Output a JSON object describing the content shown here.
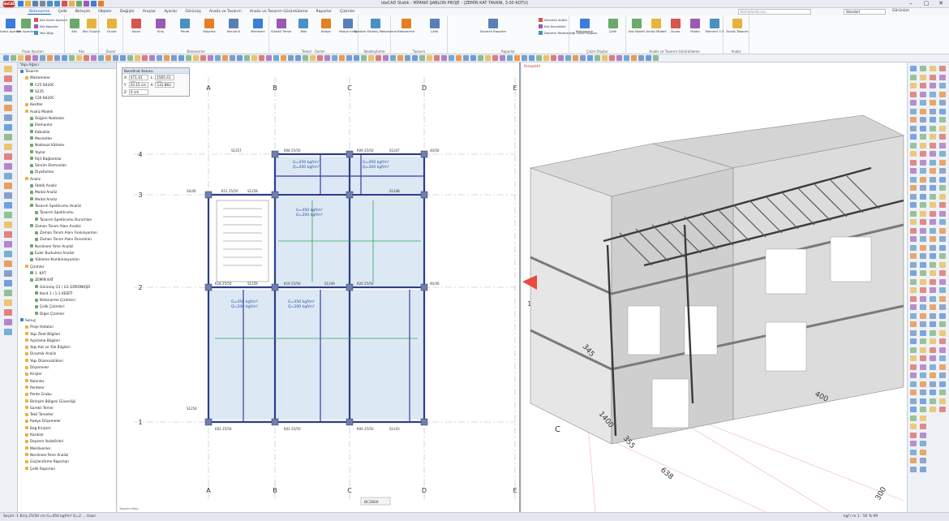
{
  "app": {
    "logo": "ideCAD",
    "title": "ideCAD Statik - MİMARİ ŞABLON PROJE - (ZEMİN KAT TAVANI, 3.00 KOTU)"
  },
  "window_controls": {
    "minimize": "–",
    "maximize": "▢",
    "close": "✕"
  },
  "tabs": [
    "Betonarme",
    "Çelik",
    "Birleşim",
    "Objeler",
    "Değiştir",
    "Araçlar",
    "Ayarlar",
    "Görünüş",
    "Analiz ve Tasarım",
    "Analiz ve Tasarım Görüntüleme",
    "Raporlar",
    "Çizimler"
  ],
  "search": {
    "placeholder": "Komutlarda ara..."
  },
  "standard_select": {
    "value": "Standart"
  },
  "view_label": "Görünüm",
  "ribbon": {
    "groups": [
      {
        "label": "Proje Ayarları",
        "buttons": [
          "Analiz Ayarları",
          "Kat Ayarları"
        ],
        "small": [
          "Kat Genel Ayarları",
          "Kat Kopyala",
          "Yeni Bilgi"
        ]
      },
      {
        "label": "Aks",
        "buttons": [
          "Aks",
          "Aks Oluştur"
        ]
      },
      {
        "label": "Duvar",
        "buttons": [
          "Duvar"
        ]
      },
      {
        "label": "Betonarme",
        "buttons": [
          "Kolon",
          "Kiriş",
          "Perde",
          "Döşeme",
          "Nervürlü",
          "Merdiven"
        ]
      },
      {
        "label": "Temel - Zemin",
        "buttons": [
          "Sürekli Temel",
          "Tekil",
          "Radye",
          "Radye Kirişi"
        ]
      },
      {
        "label": "İdealleştirme",
        "buttons": [
          "İdealize Edilmiş Mekanizma"
        ]
      },
      {
        "label": "Tasarım",
        "buttons": [
          "Betonarme",
          "Çelik"
        ]
      },
      {
        "label": "Raporlar",
        "buttons": [
          "Seçmeli Raporlar"
        ],
        "small": [
          "Dinamik Analiz",
          "Kat Kuvvetleri",
          "Deprem Yönetmeliği Genel Raporu"
        ]
      },
      {
        "label": "Çizim Oluştur",
        "buttons": [
          "Betonarme",
          "Çelik"
        ]
      },
      {
        "label": "Analiz ve Tasarım Görüntüleme",
        "buttons": [
          "Kat Modeli",
          "Analiz Modeli",
          "Duvar",
          "Modal",
          "Moment 3-3"
        ]
      },
      {
        "label": "Analiz",
        "buttons": [
          "Analiz Tasarım"
        ]
      }
    ]
  },
  "tree": {
    "header": "Yapı Ağacı",
    "items": [
      "Tasarım",
      "Malzemeler",
      "C25 B420C",
      "S235",
      "C20 B420C",
      "Kesitler",
      "Analiz Modeli",
      "Düğüm Noktaları",
      "Elemanlar",
      "Kabuklar",
      "Mesnetler",
      "Noktasal Kütleler",
      "Yaylar",
      "Rijit Bağlantılar",
      "Sönüm Elemanları",
      "Diyafamlar",
      "Analiz",
      "Statik Analiz",
      "Modal Analiz",
      "Modal Analiz",
      "Tasarım Spektrumu Analizi",
      "Tasarım Spektrumu",
      "Tasarım Spektrumu Durumları",
      "Zaman Tanım Alanı Analizi",
      "Zaman Tanım Alanı Fonksiyonları",
      "Zaman Tanım Alanı Durumları",
      "Nonlineer İtme Analizi",
      "Euler Burkulma Analizi",
      "Yükleme Kombinasyonları",
      "Çizimler",
      "1. KAT",
      "ZEMİN KAT",
      "Görünüş G1 / G1 GÖRÜNÜŞÜ",
      "Kesit 1 / 1-1 KESİTİ",
      "Betonarme Çizimleri",
      "Çelik Çizimleri",
      "Diğer Çizimler",
      "Sonuç",
      "Proje Hataları",
      "Yapı Özet Bilgileri",
      "Açıklama Bilgileri",
      "Yapı Kat ve Yük Bilgileri",
      "Dinamik Analiz",
      "Yapı Düzensizlikleri",
      "Döşemeler",
      "Kirişler",
      "Kolonlar",
      "Perdeler",
      "Perde Grubu",
      "Birleşim Bölgesi Güvenliği",
      "Sürekli Temel",
      "Tekil Temeller",
      "Radye Döşemeler",
      "Bağ Kirişleri",
      "Kazıklar",
      "Deprem İzolatörleri",
      "Merdivenler",
      "Nonlineer İtme Analizi",
      "Güçlendirme Raporları",
      "Çelik Raporları"
    ]
  },
  "coord_box": {
    "title": "Koordinat Kutusu",
    "rows": [
      {
        "k1": "X",
        "v1": "471.41 cm",
        "k2": "L",
        "v2": "1565.41 cm"
      },
      {
        "k1": "Y",
        "v1": "33.15 cm",
        "k2": "A",
        "v2": "131.883"
      },
      {
        "k1": "Z",
        "v1": "0 cm",
        "k2": "",
        "v2": ""
      }
    ]
  },
  "plan": {
    "axes_x": [
      "A",
      "B",
      "C",
      "D",
      "E"
    ],
    "axes_y": [
      "4",
      "3",
      "2",
      "1"
    ],
    "load_g": "G=450 kgf/m²",
    "load_q": "Q=200 kgf/m²",
    "beam_labels": [
      "K08 25/50",
      "K09 25/50",
      "K11 25/50",
      "K18 25/50",
      "K19 25/50",
      "K20 25/50",
      "K02 25/50",
      "K03 25/50",
      "K04 25/50"
    ],
    "dim_labels": [
      "S1257",
      "S1258",
      "S1259",
      "S1254",
      "S1247",
      "S1248",
      "S1249",
      "S1243",
      "40/50",
      "30/40",
      "40/40"
    ],
    "bottom_tag": "BC2800",
    "note": "Tasarım Notu"
  },
  "view3d": {
    "tag": "Perspektif",
    "dims": [
      "345",
      "400",
      "1400",
      "355",
      "638",
      "300"
    ],
    "axis_c": "C",
    "axis_num": "1"
  },
  "status": {
    "left": "Seçim: 1 Kiriş 25/50 cm G=450 kgf/m² Q=2 ... Hazır",
    "right": "kgf / m     1 : 50     % 99"
  }
}
